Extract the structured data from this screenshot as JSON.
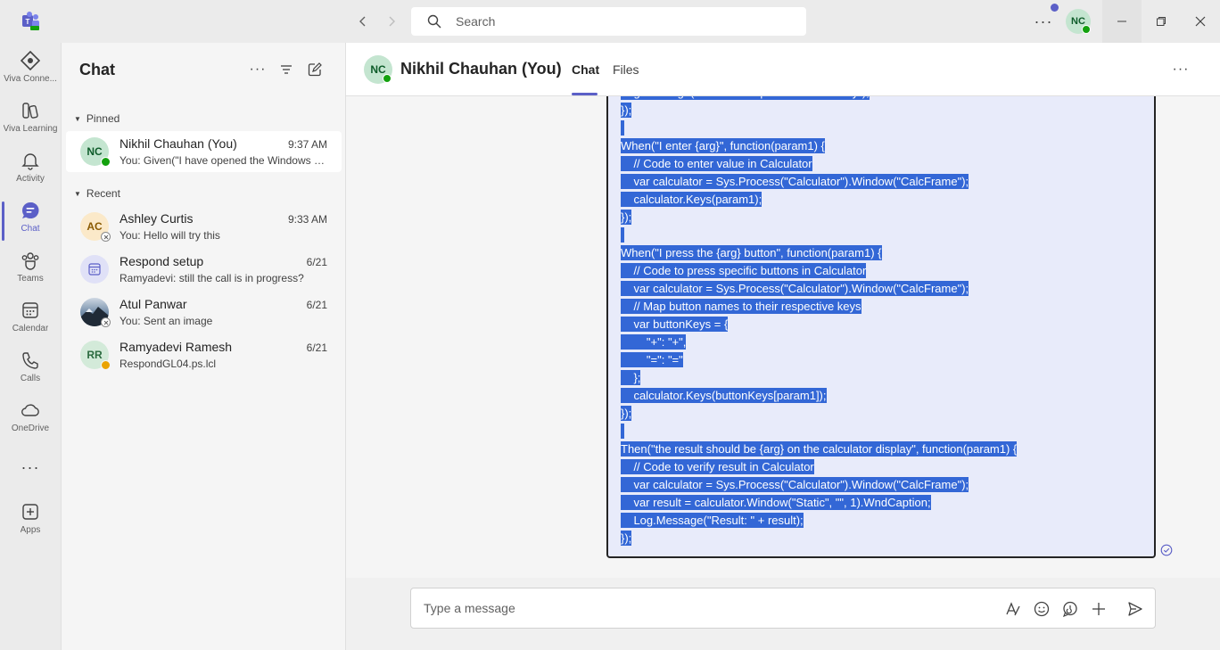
{
  "titlebar": {
    "search_placeholder": "Search",
    "user_initials": "NC"
  },
  "rail": {
    "items": [
      {
        "label": "Viva Conne...",
        "icon": "viva-connections-icon"
      },
      {
        "label": "Viva Learning",
        "icon": "viva-learning-icon"
      },
      {
        "label": "Activity",
        "icon": "bell-icon"
      },
      {
        "label": "Chat",
        "icon": "chat-icon"
      },
      {
        "label": "Teams",
        "icon": "teams-icon"
      },
      {
        "label": "Calendar",
        "icon": "calendar-icon"
      },
      {
        "label": "Calls",
        "icon": "phone-icon"
      },
      {
        "label": "OneDrive",
        "icon": "cloud-icon"
      },
      {
        "label": "Apps",
        "icon": "plus-square-icon"
      }
    ]
  },
  "chatlist": {
    "title": "Chat",
    "pinned_label": "Pinned",
    "recent_label": "Recent",
    "pinned": [
      {
        "initials": "NC",
        "name": "Nikhil Chauhan (You)",
        "time": "9:37 AM",
        "preview": "You: Given(\"I have opened the Windows Calculator\"..."
      }
    ],
    "recent": [
      {
        "initials": "AC",
        "name": "Ashley Curtis",
        "time": "9:33 AM",
        "preview": "You: Hello will try this"
      },
      {
        "initials": "",
        "name": "Respond setup",
        "time": "6/21",
        "preview": "Ramyadevi: still the call is in progress?"
      },
      {
        "initials": "",
        "name": "Atul Panwar",
        "time": "6/21",
        "preview": "You: Sent an image"
      },
      {
        "initials": "RR",
        "name": "Ramyadevi Ramesh",
        "time": "6/21",
        "preview": "RespondGL04.ps.lcl"
      }
    ],
    "colors": {
      "nc_avatar": "#c4e5d0",
      "ac_avatar": "#fbe9c9",
      "rr_avatar": "#d3ead9",
      "group_avatar": "#e0e1f7"
    }
  },
  "main": {
    "initials": "NC",
    "name": "Nikhil Chauhan (You)",
    "tab_chat": "Chat",
    "tab_files": "Files",
    "code_lines": [
      "Log.Message(\"Calculator opened successfully\");",
      "});",
      "",
      "When(\"I enter {arg}\", function(param1) {",
      "    // Code to enter value in Calculator",
      "    var calculator = Sys.Process(\"Calculator\").Window(\"CalcFrame\");",
      "    calculator.Keys(param1);",
      "});",
      "",
      "When(\"I press the {arg} button\", function(param1) {",
      "    // Code to press specific buttons in Calculator",
      "    var calculator = Sys.Process(\"Calculator\").Window(\"CalcFrame\");",
      "    // Map button names to their respective keys",
      "    var buttonKeys = {",
      "        \"+\": \"+\",",
      "        \"=\": \"=\"",
      "    };",
      "    calculator.Keys(buttonKeys[param1]);",
      "});",
      "",
      "Then(\"the result should be {arg} on the calculator display\", function(param1) {",
      "    // Code to verify result in Calculator",
      "    var calculator = Sys.Process(\"Calculator\").Window(\"CalcFrame\");",
      "    var result = calculator.Window(\"Static\", \"\", 1).WndCaption;",
      "    Log.Message(\"Result: \" + result);",
      "});"
    ],
    "composer_placeholder": "Type a message",
    "accent_color": "#5b5fc7",
    "selection_color": "#3367d6"
  }
}
